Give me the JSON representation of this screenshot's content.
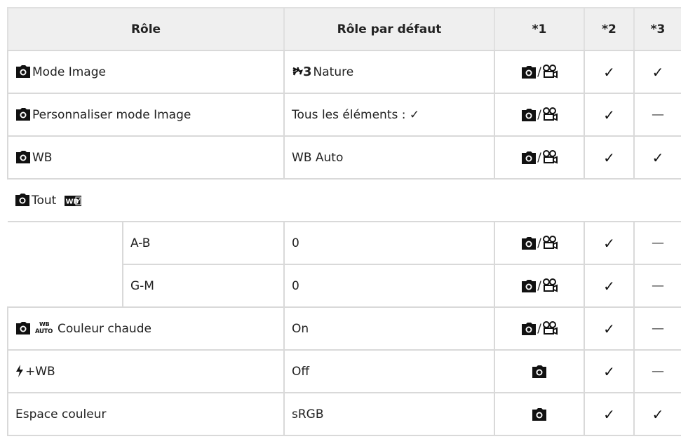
{
  "headers": {
    "role": "Rôle",
    "default": "Rôle par défaut",
    "n1": "*1",
    "n2": "*2",
    "n3": "*3"
  },
  "rows": [
    {
      "role": "Mode Image",
      "default_prefix": "3",
      "default": "Nature",
      "c2": "✓",
      "c3": "✓"
    },
    {
      "role": "Personnaliser mode Image",
      "default": "Tous les éléments : ✓",
      "c2": "✓",
      "c3": "—"
    },
    {
      "role": "WB",
      "default": "WB Auto",
      "c2": "✓",
      "c3": "✓"
    },
    {
      "role": "Tout",
      "badge": "WB±"
    },
    {
      "sub": "A-B",
      "default": "0",
      "c2": "✓",
      "c3": "—"
    },
    {
      "sub": "G-M",
      "default": "0",
      "c2": "✓",
      "c3": "—"
    },
    {
      "role_badge": "WB AUTO",
      "role": "Couleur chaude",
      "default": "On",
      "c2": "✓",
      "c3": "—"
    },
    {
      "role": "+WB",
      "default": "Off",
      "c2": "✓",
      "c3": "—"
    },
    {
      "role": "Espace couleur",
      "default": "sRGB",
      "c2": "✓",
      "c3": "✓"
    }
  ],
  "icons": {
    "camera": "camera-icon",
    "movie": "movie-camera-icon",
    "flash": "flash-icon",
    "nature": "nature-icon",
    "wb_auto": "wb-auto-icon",
    "wb_comp": "wb-compensation-icon"
  }
}
